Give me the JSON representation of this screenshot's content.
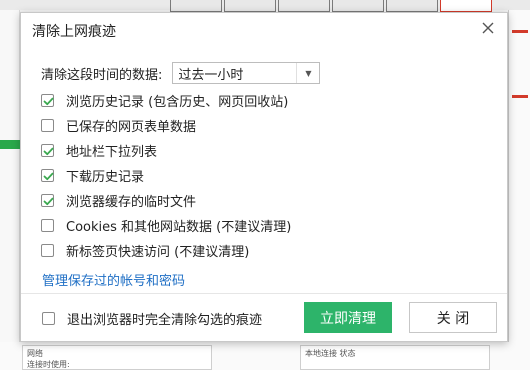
{
  "dialog": {
    "title": "清除上网痕迹",
    "range_label": "清除这段时间的数据:",
    "range_selected": "过去一小时",
    "options": [
      {
        "label": "浏览历史记录 (包含历史、网页回收站)",
        "checked": true
      },
      {
        "label": "已保存的网页表单数据",
        "checked": false
      },
      {
        "label": "地址栏下拉列表",
        "checked": true
      },
      {
        "label": "下载历史记录",
        "checked": true
      },
      {
        "label": "浏览器缓存的临时文件",
        "checked": true
      },
      {
        "label": "Cookies 和其他网站数据 (不建议清理)",
        "checked": false
      },
      {
        "label": "新标签页快速访问 (不建议清理)",
        "checked": false
      }
    ],
    "manage_link": "管理保存过的帐号和密码",
    "exit_clear_label": "退出浏览器时完全清除勾选的痕迹",
    "exit_clear_checked": false,
    "clear_button": "立即清理",
    "close_button": "关 闭"
  },
  "colors": {
    "accent_green": "#2db46a",
    "link_blue": "#1f6fc5",
    "check_green": "#3aa84f"
  },
  "background_panel": {
    "left_label": "网络",
    "left_sub": "连接时使用:",
    "right_label": "本地连接 状态"
  }
}
